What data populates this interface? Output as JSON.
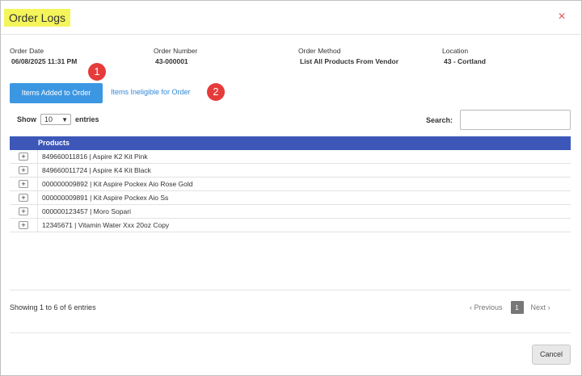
{
  "modal": {
    "title": "Order Logs",
    "close_icon": "×"
  },
  "meta": [
    {
      "label": "Order Date",
      "value": "06/08/2025 11:31 PM"
    },
    {
      "label": "Order Number",
      "value": "43-000001"
    },
    {
      "label": "Order Method",
      "value": "List All Products From Vendor"
    },
    {
      "label": "Location",
      "value": "43 - Cortland"
    }
  ],
  "tabs": {
    "active_label": "Items Added to Order",
    "inactive_label": "Items Ineligible for Order"
  },
  "badges": [
    "1",
    "2"
  ],
  "table_controls": {
    "show_label": "Show",
    "page_size": "10",
    "entries_label": "entries",
    "search_label": "Search:",
    "search_value": ""
  },
  "grid": {
    "header": "Products",
    "expand_glyph": "+",
    "rows": [
      "849660011816 | Aspire K2 Kit Pink",
      "849660011724 | Aspire K4 Kit Black",
      "000000009892 | Kit Aspire Pockex Aio Rose Gold",
      "000000009891 | Kit Aspire Pockex Aio Ss",
      "000000123457 | Moro Sopari",
      "12345671 | Vitamin Water Xxx 20oz Copy"
    ]
  },
  "footer": {
    "info": "Showing 1 to 6 of 6 entries",
    "prev_label": "Previous",
    "current_page": "1",
    "next_label": "Next",
    "cancel_label": "Cancel"
  },
  "colors": {
    "primary": "#3c97e3",
    "grid_header": "#3d57b8",
    "badge": "#e63b3b",
    "title_highlight": "#f4f55a",
    "close": "#d9534f"
  },
  "icons": {
    "close": "close-icon",
    "dropdown": "chevron-down-icon",
    "expand": "plus-icon",
    "prev": "chevron-left-icon",
    "next": "chevron-right-icon"
  }
}
